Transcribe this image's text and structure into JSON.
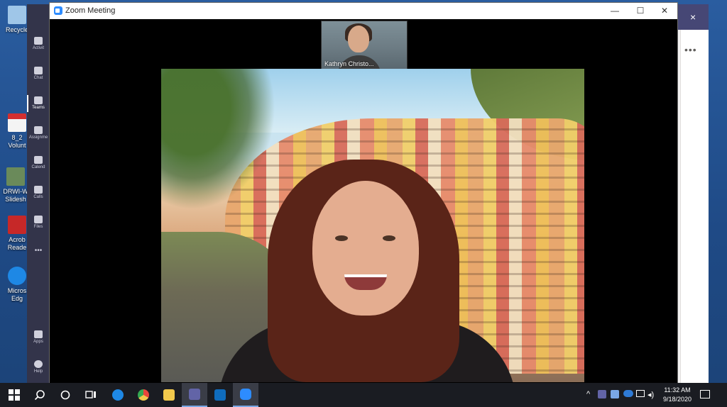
{
  "desktop": {
    "icons": [
      {
        "label": "Recycle",
        "icon": "recycle-bin-icon"
      },
      {
        "label": "8_2 Volunt",
        "icon": "pdf-file-icon"
      },
      {
        "label": "DRWI-W Slidesh",
        "icon": "slideshow-file-icon"
      },
      {
        "label": "Acrob Reade",
        "icon": "acrobat-reader-icon"
      },
      {
        "label": "Micros Edg",
        "icon": "edge-icon"
      }
    ]
  },
  "teams": {
    "rail": [
      {
        "label": "Activit",
        "icon": "bell-icon"
      },
      {
        "label": "Chat",
        "icon": "chat-icon"
      },
      {
        "label": "Teams",
        "icon": "teams-icon"
      },
      {
        "label": "Assignme",
        "icon": "assignments-icon"
      },
      {
        "label": "Calend",
        "icon": "calendar-icon"
      },
      {
        "label": "Calls",
        "icon": "phone-icon"
      },
      {
        "label": "Files",
        "icon": "file-icon"
      },
      {
        "label": "•••",
        "icon": "more-icon"
      },
      {
        "label": "Apps",
        "icon": "apps-icon"
      },
      {
        "label": "Help",
        "icon": "help-icon"
      }
    ],
    "more": "•••",
    "back": "‹",
    "close": "×"
  },
  "zoom": {
    "title": "Zoom Meeting",
    "minimize": "—",
    "maximize": "☐",
    "close": "✕",
    "thumbnail_name": "Kathryn Christo..."
  },
  "taskbar": {
    "items": [
      {
        "name": "windows-start-icon",
        "color": "#ffffff"
      },
      {
        "name": "search-icon",
        "color": "#ffffff"
      },
      {
        "name": "cortana-icon",
        "color": "#ffffff"
      },
      {
        "name": "task-view-icon",
        "color": "#ffffff"
      },
      {
        "name": "edge-icon",
        "color": "#1e88e5"
      },
      {
        "name": "chrome-icon",
        "color": "#e8453c"
      },
      {
        "name": "file-explorer-icon",
        "color": "#f2c94c"
      },
      {
        "name": "teams-icon",
        "color": "#6264a7"
      },
      {
        "name": "outlook-icon",
        "color": "#0f6cbd"
      },
      {
        "name": "zoom-icon",
        "color": "#2d8cff"
      }
    ],
    "time": "11:32 AM",
    "date": "9/18/2020"
  }
}
